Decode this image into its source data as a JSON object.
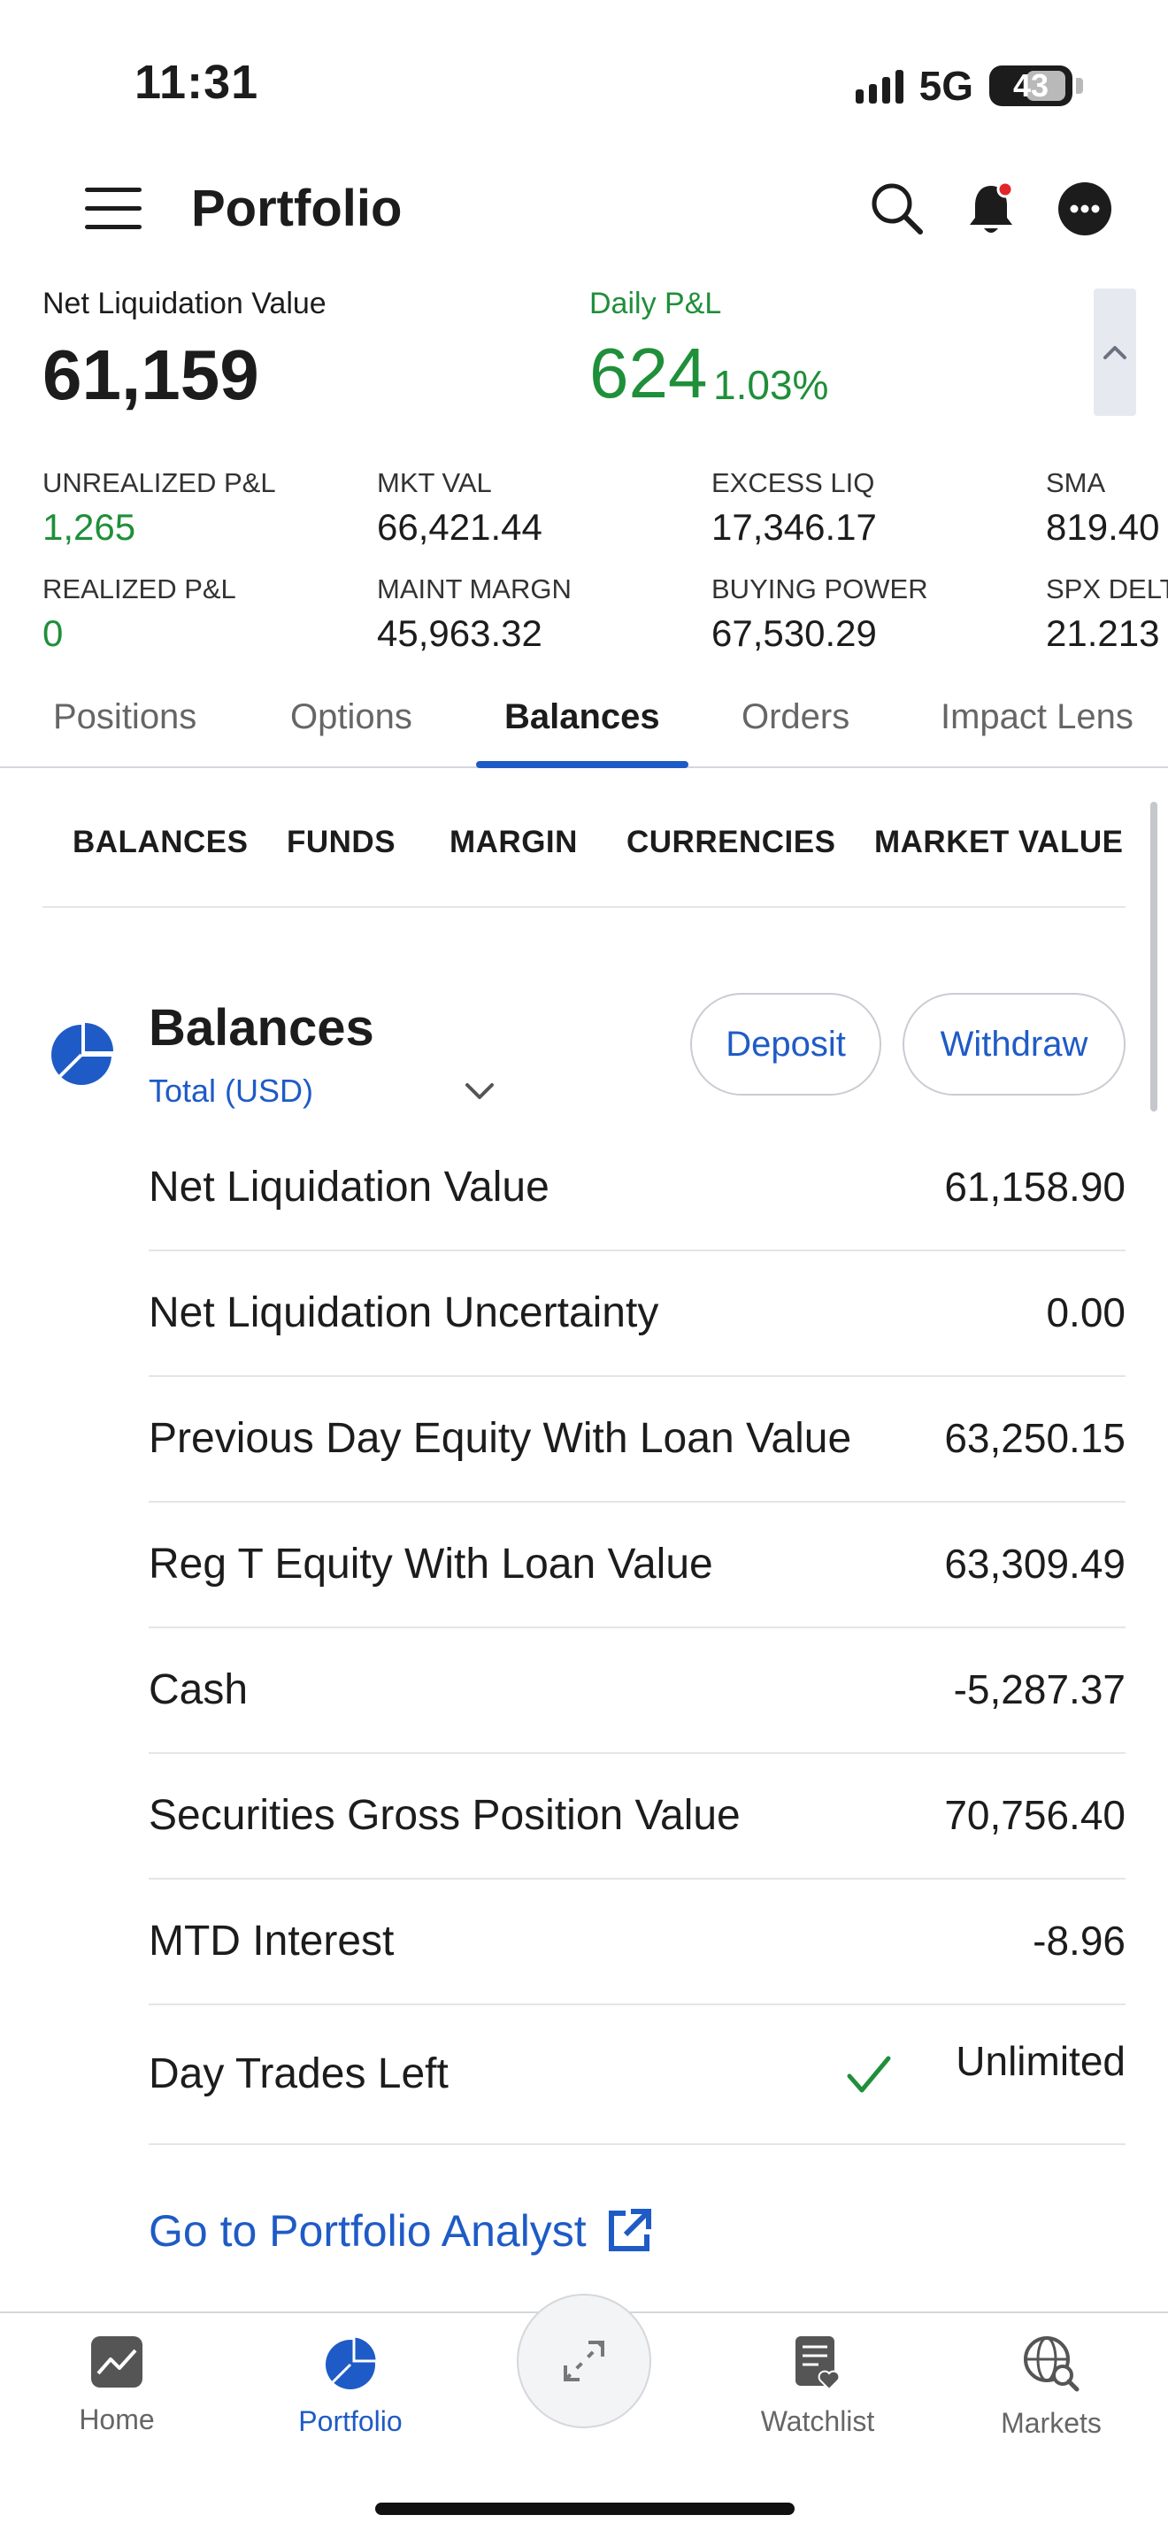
{
  "status_bar": {
    "time": "11:31",
    "network": "5G",
    "battery": "43"
  },
  "header": {
    "title": "Portfolio"
  },
  "summary": {
    "nlv_label": "Net Liquidation Value",
    "nlv_value": "61,159",
    "daily_pl_label": "Daily P&L",
    "daily_pl_value": "624",
    "daily_pl_pct": "1.03%",
    "metrics": [
      {
        "label": "UNREALIZED P&L",
        "value": "1,265",
        "color": "#1f8f3a"
      },
      {
        "label": "MKT VAL",
        "value": "66,421.44"
      },
      {
        "label": "EXCESS LIQ",
        "value": "17,346.17"
      },
      {
        "label": "SMA",
        "value": "819.40"
      },
      {
        "label": "REALIZED P&L",
        "value": "0",
        "color": "#1f8f3a"
      },
      {
        "label": "MAINT MARGN",
        "value": "45,963.32"
      },
      {
        "label": "BUYING POWER",
        "value": "67,530.29"
      },
      {
        "label": "SPX DELTA",
        "value": "21.213"
      }
    ]
  },
  "tabs": [
    {
      "label": "Positions"
    },
    {
      "label": "Options"
    },
    {
      "label": "Balances",
      "active": true
    },
    {
      "label": "Orders"
    },
    {
      "label": "Impact Lens"
    }
  ],
  "subtabs": [
    "BALANCES",
    "FUNDS",
    "MARGIN",
    "CURRENCIES",
    "MARKET VALUE"
  ],
  "balances": {
    "title": "Balances",
    "currency": "Total (USD)",
    "deposit_label": "Deposit",
    "withdraw_label": "Withdraw",
    "rows": [
      {
        "label": "Net Liquidation Value",
        "value": "61,158.90"
      },
      {
        "label": "Net Liquidation Uncertainty",
        "value": "0.00"
      },
      {
        "label": "Previous Day Equity With Loan Value",
        "value": "63,250.15"
      },
      {
        "label": "Reg T Equity With Loan Value",
        "value": "63,309.49"
      },
      {
        "label": "Cash",
        "value": "-5,287.37"
      },
      {
        "label": "Securities Gross Position Value",
        "value": "70,756.40"
      },
      {
        "label": "MTD Interest",
        "value": "-8.96"
      },
      {
        "label": "Day Trades Left",
        "value": "Unlimited"
      }
    ],
    "analyst_link": "Go to Portfolio Analyst"
  },
  "bottom_nav": [
    {
      "label": "Home",
      "icon": "home-chart-icon"
    },
    {
      "label": "Portfolio",
      "icon": "pie-chart-icon",
      "active": true
    },
    {
      "label": "Watchlist",
      "icon": "watchlist-icon"
    },
    {
      "label": "Markets",
      "icon": "globe-search-icon"
    }
  ],
  "colors": {
    "accent": "#1e5bc6",
    "positive": "#1f8f3a"
  }
}
